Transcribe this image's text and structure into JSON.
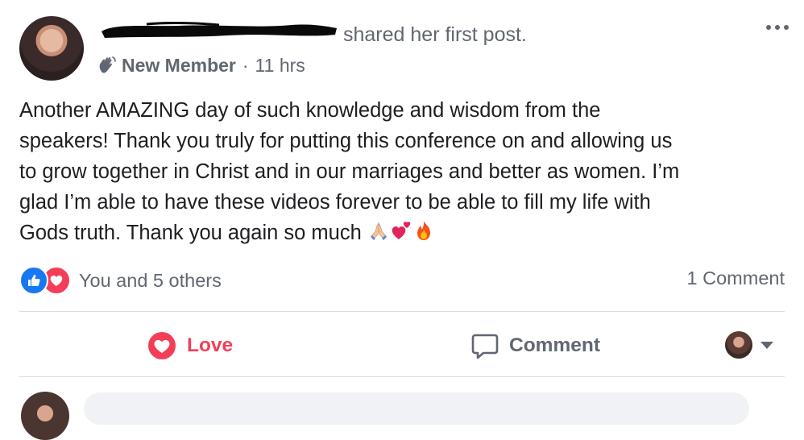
{
  "post": {
    "shared_text": "shared her first post.",
    "badge_label": "New Member",
    "separator": "·",
    "timestamp": "11 hrs",
    "body_lines": [
      "Another AMAZING day of such knowledge and wisdom from the",
      "speakers! Thank you truly for putting this conference on and allowing us",
      "to grow together in Christ and in our marriages and better as women. I’m",
      "glad I’m able to have these videos forever to be able to fill my life with",
      "Gods truth. Thank you again so much"
    ],
    "trailing_emojis": [
      "folded-hands-emoji",
      "two-hearts-emoji",
      "fire-emoji"
    ]
  },
  "engagement": {
    "reactions_text": "You and 5 others",
    "comments_text": "1 Comment",
    "reaction_types": [
      "like",
      "love"
    ]
  },
  "actions": {
    "love_label": "Love",
    "comment_label": "Comment"
  },
  "colors": {
    "love_red": "#f33e58",
    "like_blue": "#1877f2",
    "secondary_text": "#606770",
    "divider": "#dadde1"
  }
}
